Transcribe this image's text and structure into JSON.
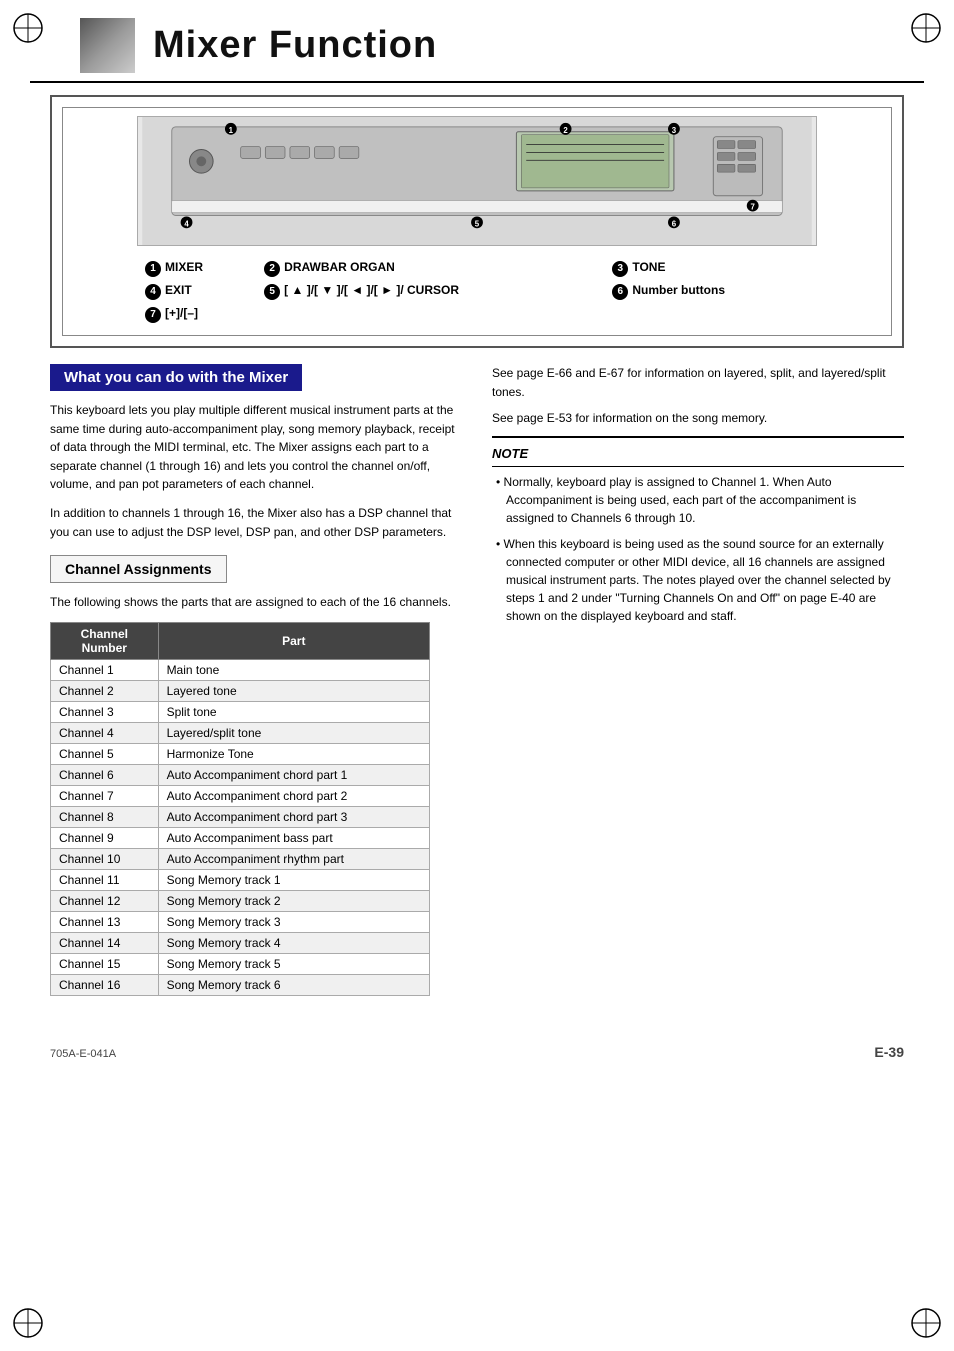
{
  "page": {
    "title": "Mixer Function",
    "footer_code": "705A-E-041A",
    "footer_page": "E-39"
  },
  "header": {
    "title": "Mixer Function"
  },
  "diagram": {
    "labels": [
      {
        "num": "1",
        "text": "MIXER"
      },
      {
        "num": "2",
        "text": "DRAWBAR ORGAN"
      },
      {
        "num": "3",
        "text": "TONE"
      },
      {
        "num": "4",
        "text": "EXIT"
      },
      {
        "num": "5",
        "text": "[ ▲ ]/[ ▼ ]/[ ◄ ]/[ ► ]/ CURSOR"
      },
      {
        "num": "6",
        "text": "Number buttons"
      },
      {
        "num": "7",
        "text": "[+]/[–]"
      }
    ]
  },
  "section1": {
    "heading": "What you can do with the Mixer",
    "paragraphs": [
      "This keyboard lets you play multiple different musical instrument parts at the same time during auto-accompaniment play, song memory playback, receipt of data through the MIDI terminal, etc. The Mixer assigns each part to a separate channel (1 through 16) and lets you control the channel on/off, volume, and pan pot parameters of each channel.",
      "In addition to channels 1 through 16, the Mixer also has a DSP channel that you can use to adjust the DSP level, DSP pan, and other DSP parameters."
    ]
  },
  "section1_right": {
    "paragraphs": [
      "See page E-66 and E-67 for information on layered, split, and layered/split tones.",
      "See page E-53 for information on the song memory."
    ],
    "note_title": "NOTE",
    "notes": [
      "Normally, keyboard play is assigned to Channel 1. When Auto Accompaniment is being used, each part of the accompaniment is assigned to Channels 6 through 10.",
      "When this keyboard is being used as the sound source for an externally connected computer or other MIDI device, all 16 channels are assigned musical instrument parts. The notes played over the channel selected by steps 1 and 2 under \"Turning Channels On and Off\" on page E-40 are shown on the displayed keyboard and staff."
    ]
  },
  "channel_section": {
    "heading": "Channel Assignments",
    "intro": "The following shows the parts that are assigned to each of the 16 channels.",
    "table_headers": [
      "Channel\nNumber",
      "Part"
    ],
    "rows": [
      {
        "channel": "Channel 1",
        "part": "Main tone"
      },
      {
        "channel": "Channel 2",
        "part": "Layered tone"
      },
      {
        "channel": "Channel 3",
        "part": "Split tone"
      },
      {
        "channel": "Channel 4",
        "part": "Layered/split tone"
      },
      {
        "channel": "Channel 5",
        "part": "Harmonize Tone"
      },
      {
        "channel": "Channel 6",
        "part": "Auto Accompaniment chord part 1"
      },
      {
        "channel": "Channel 7",
        "part": "Auto Accompaniment chord part 2"
      },
      {
        "channel": "Channel 8",
        "part": "Auto Accompaniment chord part 3"
      },
      {
        "channel": "Channel 9",
        "part": "Auto Accompaniment bass part"
      },
      {
        "channel": "Channel 10",
        "part": "Auto Accompaniment rhythm part"
      },
      {
        "channel": "Channel 11",
        "part": "Song Memory track 1"
      },
      {
        "channel": "Channel 12",
        "part": "Song Memory track 2"
      },
      {
        "channel": "Channel 13",
        "part": "Song Memory track 3"
      },
      {
        "channel": "Channel 14",
        "part": "Song Memory track 4"
      },
      {
        "channel": "Channel 15",
        "part": "Song Memory track 5"
      },
      {
        "channel": "Channel 16",
        "part": "Song Memory track 6"
      }
    ]
  }
}
